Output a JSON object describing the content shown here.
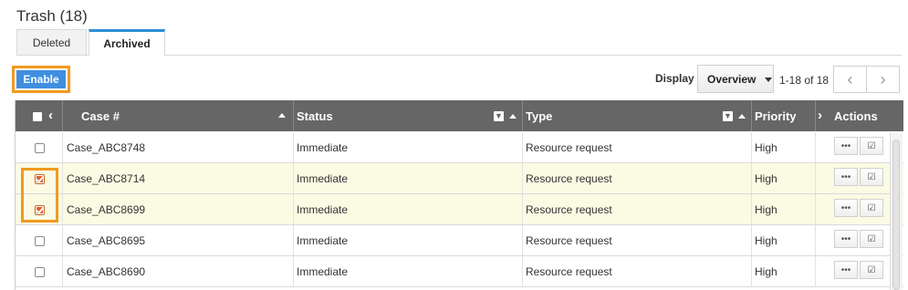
{
  "page": {
    "title": "Trash (18)"
  },
  "tabs": [
    {
      "label": "Deleted"
    },
    {
      "label": "Archived"
    }
  ],
  "toolbar": {
    "enable_label": "Enable",
    "display_label": "Display",
    "view_selected": "Overview",
    "range": "1-18 of 18",
    "prev_icon": "‹",
    "next_icon": "›"
  },
  "grid": {
    "columns": [
      "Case #",
      "Status",
      "Type",
      "Priority",
      "Actions"
    ],
    "rows": [
      {
        "case": "Case_ABC8748",
        "status": "Immediate",
        "type": "Resource request",
        "priority": "High",
        "checked": false
      },
      {
        "case": "Case_ABC8714",
        "status": "Immediate",
        "type": "Resource request",
        "priority": "High",
        "checked": true
      },
      {
        "case": "Case_ABC8699",
        "status": "Immediate",
        "type": "Resource request",
        "priority": "High",
        "checked": true
      },
      {
        "case": "Case_ABC8695",
        "status": "Immediate",
        "type": "Resource request",
        "priority": "High",
        "checked": false
      },
      {
        "case": "Case_ABC8690",
        "status": "Immediate",
        "type": "Resource request",
        "priority": "High",
        "checked": false
      }
    ],
    "action_more_icon": "•••",
    "action_edit_icon": "☑"
  },
  "colors": {
    "accent": "#3f8fe0",
    "highlight": "#f19a1f",
    "header_bg": "#666666",
    "selected_row": "#fbfbe4"
  }
}
